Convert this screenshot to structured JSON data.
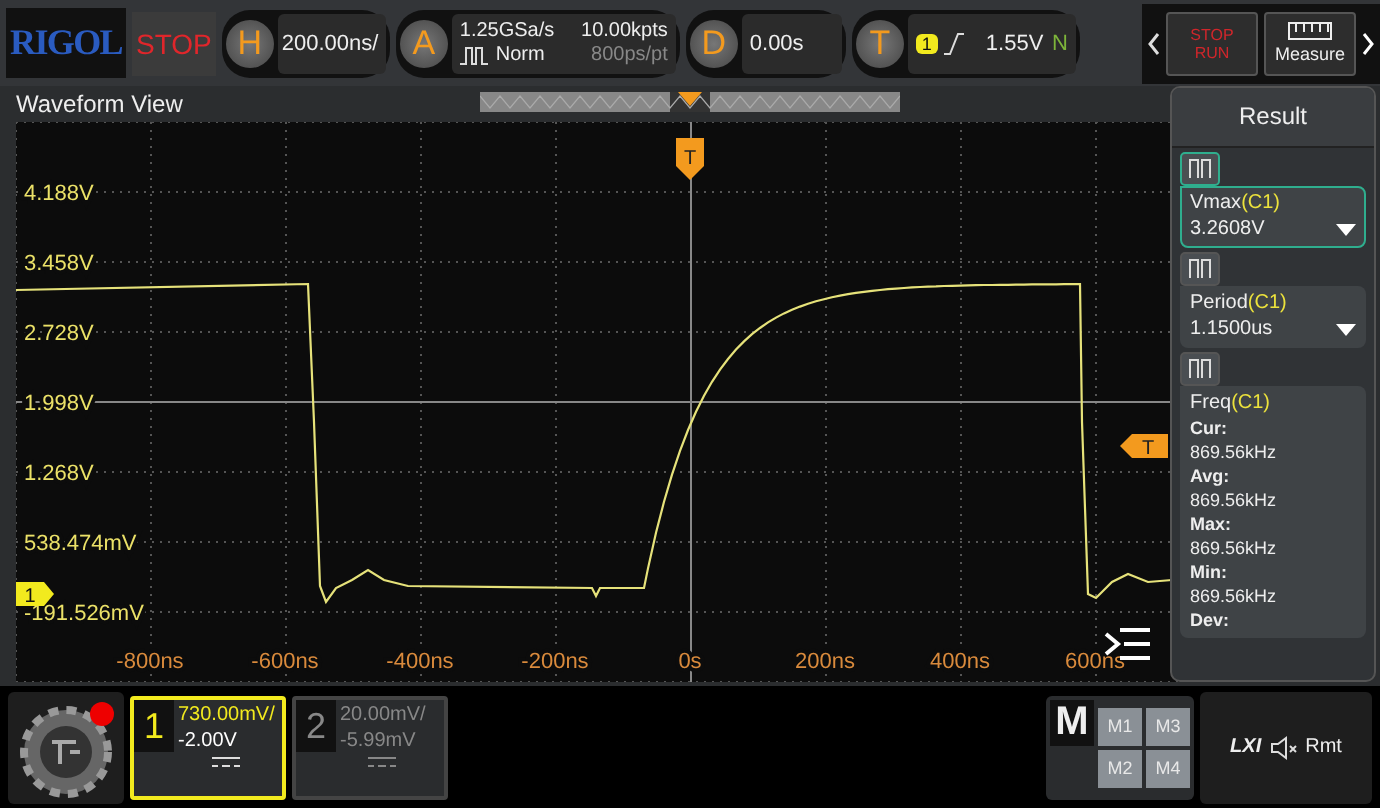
{
  "header": {
    "logo": "RIGOL",
    "run_state": "STOP",
    "horizontal": {
      "key": "H",
      "value": "200.00ns/"
    },
    "acquire": {
      "key": "A",
      "sample_rate": "1.25GSa/s",
      "memory_depth": "10.00kpts",
      "mode": "Norm",
      "resolution": "800ps/pt"
    },
    "delay": {
      "key": "D",
      "value": "0.00s"
    },
    "trigger": {
      "key": "T",
      "source": "1",
      "level": "1.55V",
      "sweep": "N"
    },
    "stop_run": {
      "top": "STOP",
      "bottom": "RUN"
    },
    "measure": {
      "label": "Measure"
    }
  },
  "waveform_view": {
    "title": "Waveform View",
    "trigger_position_marker": "T",
    "trigger_level_marker": "T",
    "channel_marker": "1",
    "y_labels": [
      "4.188V",
      "3.458V",
      "2.728V",
      "1.998V",
      "1.268V",
      "538.474mV",
      "-191.526mV"
    ],
    "x_labels": [
      "-800ns",
      "-600ns",
      "-400ns",
      "-200ns",
      "0s",
      "200ns",
      "400ns",
      "600ns"
    ]
  },
  "result_panel": {
    "title": "Result",
    "measurements": [
      {
        "kind": "single",
        "name": "Vmax",
        "source": "(C1)",
        "value": "3.2608V",
        "selected": true
      },
      {
        "kind": "single",
        "name": "Period",
        "source": "(C1)",
        "value": "1.1500us",
        "selected": false
      },
      {
        "kind": "stats",
        "name": "Freq",
        "source": "(C1)",
        "selected": false,
        "stats": [
          {
            "label": "Cur:",
            "value": "869.56kHz"
          },
          {
            "label": "Avg:",
            "value": "869.56kHz"
          },
          {
            "label": "Max:",
            "value": "869.56kHz"
          },
          {
            "label": "Min:",
            "value": "869.56kHz"
          },
          {
            "label": "Dev:"
          }
        ]
      }
    ]
  },
  "channels": [
    {
      "number": "1",
      "scale": "730.00mV/",
      "offset": "-2.00V",
      "on": true
    },
    {
      "number": "2",
      "scale": "20.00mV/",
      "offset": "-5.99mV",
      "on": false
    }
  ],
  "math": {
    "key": "M",
    "buttons": [
      "M1",
      "M3",
      "M2",
      "M4"
    ]
  },
  "status": {
    "lxi": "LXI",
    "remote": "Rmt"
  }
}
